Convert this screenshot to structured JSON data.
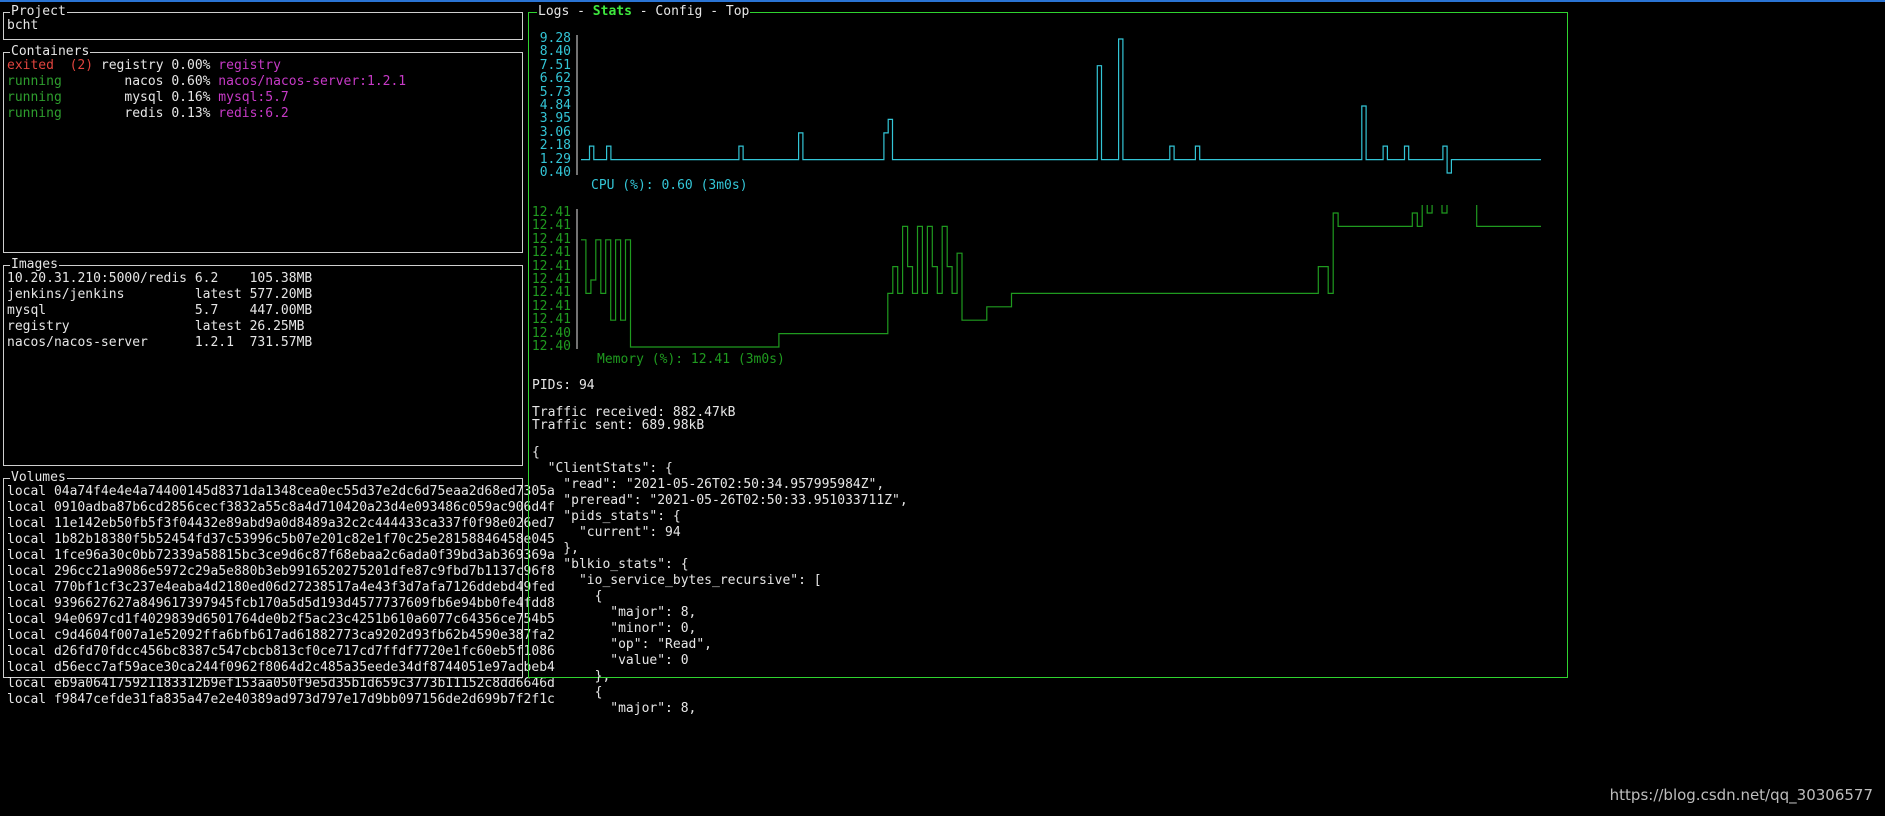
{
  "project": {
    "title": "Project",
    "name": "bcht"
  },
  "containers": {
    "title": "Containers",
    "rows": [
      {
        "state": "exited",
        "code": "(2)",
        "name": "registry",
        "cpu": "0.00%",
        "image": "registry"
      },
      {
        "state": "running",
        "code": "",
        "name": "nacos",
        "cpu": "0.60%",
        "image": "nacos/nacos-server:1.2.1"
      },
      {
        "state": "running",
        "code": "",
        "name": "mysql",
        "cpu": "0.16%",
        "image": "mysql:5.7"
      },
      {
        "state": "running",
        "code": "",
        "name": "redis",
        "cpu": "0.13%",
        "image": "redis:6.2"
      }
    ]
  },
  "images": {
    "title": "Images",
    "rows": [
      {
        "repo": "10.20.31.210:5000/redis",
        "tag": "6.2",
        "size": "105.38MB"
      },
      {
        "repo": "jenkins/jenkins",
        "tag": "latest",
        "size": "577.20MB"
      },
      {
        "repo": "mysql",
        "tag": "5.7",
        "size": "447.00MB"
      },
      {
        "repo": "registry",
        "tag": "latest",
        "size": "26.25MB"
      },
      {
        "repo": "nacos/nacos-server",
        "tag": "1.2.1",
        "size": "731.57MB"
      }
    ]
  },
  "volumes": {
    "title": "Volumes",
    "rows": [
      {
        "driver": "local",
        "name": "04a74f4e4e4a74400145d8371da1348cea0ec55d37e2dc6d75eaa2d68ed7305a"
      },
      {
        "driver": "local",
        "name": "0910adba87b6cd2856cecf3832a55c8a4d710420a23d4e093486c059ac906d4f"
      },
      {
        "driver": "local",
        "name": "11e142eb50fb5f3f04432e89abd9a0d8489a32c2c444433ca337f0f98e026ed7"
      },
      {
        "driver": "local",
        "name": "1b82b18380f5b52454fd37c53996c5b07e201c82e1f70c25e28158846458e045"
      },
      {
        "driver": "local",
        "name": "1fce96a30c0bb72339a58815bc3ce9d6c87f68ebaa2c6ada0f39bd3ab369369a"
      },
      {
        "driver": "local",
        "name": "296cc21a9086e5972c29a5e880b3eb9916520275201dfe87c9fbd7b1137c96f8"
      },
      {
        "driver": "local",
        "name": "770bf1cf3c237e4eaba4d2180ed06d27238517a4e43f3d7afa7126ddebd49fed"
      },
      {
        "driver": "local",
        "name": "9396627627a849617397945fcb170a5d5d193d4577737609fb6e94bb0fe4fdd8"
      },
      {
        "driver": "local",
        "name": "94e0697cd1f4029839d6501764de0b2f5ac23c4251b610a6077c64356ce754b5"
      },
      {
        "driver": "local",
        "name": "c9d4604f007a1e52092ffa6bfb617ad61882773ca9202d93fb62b4590e387fa2"
      },
      {
        "driver": "local",
        "name": "d26fd70fdcc456bc8387c547cbcb813cf0ce717cd7ffdf7720e1fc60eb5f1086"
      },
      {
        "driver": "local",
        "name": "d56ecc7af59ace30ca244f0962f8064d2c485a35eede34df8744051e97acbeb4"
      },
      {
        "driver": "local",
        "name": "eb9a064175921183312b9ef153aa050f9e5d35b1d659c3773b11152c8dd6646d"
      },
      {
        "driver": "local",
        "name": "f9847cefde31fa835a47e2e40389ad973d797e17d9bb097156de2d699b7f2f1c"
      }
    ]
  },
  "tabs": {
    "items": [
      {
        "label": "Logs",
        "active": false
      },
      {
        "label": "Stats",
        "active": true
      },
      {
        "label": "Config",
        "active": false
      },
      {
        "label": "Top",
        "active": false
      }
    ],
    "separator": "-"
  },
  "cpu_chart": {
    "ylabels": [
      "9.28",
      "8.40",
      "7.51",
      "6.62",
      "5.73",
      "4.84",
      "3.95",
      "3.06",
      "2.18",
      "1.29",
      "0.40"
    ],
    "caption": "CPU (%): 0.60 (3m0s)",
    "color": "#33c5d6"
  },
  "mem_chart": {
    "ylabels": [
      "12.41",
      "12.41",
      "12.41",
      "12.41",
      "12.41",
      "12.41",
      "12.41",
      "12.41",
      "12.41",
      "12.40",
      "12.40"
    ],
    "caption": "Memory (%): 12.41 (3m0s)",
    "color": "#1f9a1f"
  },
  "chart_data": [
    {
      "type": "line",
      "ylim": [
        0.4,
        9.28
      ],
      "series": [
        {
          "name": "CPU (%)",
          "values": [
            1.29,
            1.29,
            2.18,
            1.29,
            1.29,
            1.29,
            2.18,
            1.29,
            1.29,
            1.29,
            1.29,
            1.29,
            1.29,
            1.29,
            1.29,
            1.29,
            1.29,
            1.29,
            1.29,
            1.29,
            1.29,
            1.29,
            1.29,
            1.29,
            1.29,
            1.29,
            1.29,
            1.29,
            1.29,
            1.29,
            1.29,
            1.29,
            1.29,
            1.29,
            1.29,
            1.29,
            1.29,
            2.18,
            1.29,
            1.29,
            1.29,
            1.29,
            1.29,
            1.29,
            1.29,
            1.29,
            1.29,
            1.29,
            1.29,
            1.29,
            1.29,
            3.06,
            1.29,
            1.29,
            1.29,
            1.29,
            1.29,
            1.29,
            1.29,
            1.29,
            1.29,
            1.29,
            1.29,
            1.29,
            1.29,
            1.29,
            1.29,
            1.29,
            1.29,
            1.29,
            1.29,
            3.06,
            3.95,
            1.29,
            1.29,
            1.29,
            1.29,
            1.29,
            1.29,
            1.29,
            1.29,
            1.29,
            1.29,
            1.29,
            1.29,
            1.29,
            1.29,
            1.29,
            1.29,
            1.29,
            1.29,
            1.29,
            1.29,
            1.29,
            1.29,
            1.29,
            1.29,
            1.29,
            1.29,
            1.29,
            1.29,
            1.29,
            1.29,
            1.29,
            1.29,
            1.29,
            1.29,
            1.29,
            1.29,
            1.29,
            1.29,
            1.29,
            1.29,
            1.29,
            1.29,
            1.29,
            1.29,
            1.29,
            1.29,
            1.29,
            1.29,
            7.51,
            1.29,
            1.29,
            1.29,
            1.29,
            9.28,
            1.29,
            1.29,
            1.29,
            1.29,
            1.29,
            1.29,
            1.29,
            1.29,
            1.29,
            1.29,
            1.29,
            2.18,
            1.29,
            1.29,
            1.29,
            1.29,
            1.29,
            2.18,
            1.29,
            1.29,
            1.29,
            1.29,
            1.29,
            1.29,
            1.29,
            1.29,
            1.29,
            1.29,
            1.29,
            1.29,
            1.29,
            1.29,
            1.29,
            1.29,
            1.29,
            1.29,
            1.29,
            1.29,
            1.29,
            1.29,
            1.29,
            1.29,
            1.29,
            1.29,
            1.29,
            1.29,
            1.29,
            1.29,
            1.29,
            1.29,
            1.29,
            1.29,
            1.29,
            1.29,
            1.29,
            1.29,
            4.84,
            1.29,
            1.29,
            1.29,
            1.29,
            2.18,
            1.29,
            1.29,
            1.29,
            1.29,
            2.18,
            1.29,
            1.29,
            1.29,
            1.29,
            1.29,
            1.29,
            1.29,
            1.29,
            2.18,
            0.4,
            1.29,
            1.29,
            1.29,
            1.29,
            1.29,
            1.29,
            1.29,
            1.29,
            1.29,
            1.29,
            1.29,
            1.29,
            1.29,
            1.29,
            1.29,
            1.29,
            1.29,
            1.29,
            1.29,
            1.29,
            1.29
          ]
        }
      ]
    },
    {
      "type": "line",
      "ylim": [
        12.4,
        12.41
      ],
      "series": [
        {
          "name": "Memory (%)",
          "values": [
            12.408,
            12.404,
            12.405,
            12.408,
            12.404,
            12.408,
            12.402,
            12.408,
            12.402,
            12.408,
            12.4,
            12.4,
            12.4,
            12.4,
            12.4,
            12.4,
            12.4,
            12.4,
            12.4,
            12.4,
            12.4,
            12.4,
            12.4,
            12.4,
            12.4,
            12.4,
            12.4,
            12.4,
            12.4,
            12.4,
            12.4,
            12.4,
            12.4,
            12.4,
            12.4,
            12.4,
            12.4,
            12.4,
            12.4,
            12.4,
            12.401,
            12.401,
            12.401,
            12.401,
            12.401,
            12.401,
            12.401,
            12.401,
            12.401,
            12.401,
            12.401,
            12.401,
            12.401,
            12.401,
            12.401,
            12.401,
            12.401,
            12.401,
            12.401,
            12.401,
            12.401,
            12.401,
            12.404,
            12.406,
            12.404,
            12.409,
            12.406,
            12.404,
            12.409,
            12.404,
            12.409,
            12.406,
            12.404,
            12.409,
            12.406,
            12.404,
            12.407,
            12.402,
            12.402,
            12.402,
            12.402,
            12.402,
            12.403,
            12.403,
            12.403,
            12.403,
            12.403,
            12.404,
            12.404,
            12.404,
            12.404,
            12.404,
            12.404,
            12.404,
            12.404,
            12.404,
            12.404,
            12.404,
            12.404,
            12.404,
            12.404,
            12.404,
            12.404,
            12.404,
            12.404,
            12.404,
            12.404,
            12.404,
            12.404,
            12.404,
            12.404,
            12.404,
            12.404,
            12.404,
            12.404,
            12.404,
            12.404,
            12.404,
            12.404,
            12.404,
            12.404,
            12.404,
            12.404,
            12.404,
            12.404,
            12.404,
            12.404,
            12.404,
            12.404,
            12.404,
            12.404,
            12.404,
            12.404,
            12.404,
            12.404,
            12.404,
            12.404,
            12.404,
            12.404,
            12.404,
            12.404,
            12.404,
            12.404,
            12.404,
            12.404,
            12.404,
            12.404,
            12.404,
            12.404,
            12.406,
            12.406,
            12.404,
            12.41,
            12.409,
            12.409,
            12.409,
            12.409,
            12.409,
            12.409,
            12.409,
            12.409,
            12.409,
            12.409,
            12.409,
            12.409,
            12.409,
            12.409,
            12.409,
            12.41,
            12.409,
            12.411,
            12.41,
            12.411,
            12.412,
            12.41,
            12.412,
            12.412,
            12.411,
            12.411,
            12.412,
            12.411,
            12.409,
            12.409,
            12.409,
            12.409,
            12.409,
            12.409,
            12.409,
            12.409,
            12.409,
            12.409,
            12.409,
            12.409,
            12.409
          ]
        }
      ]
    }
  ],
  "pids": "PIDs: 94",
  "traffic_received": "Traffic received: 882.47kB",
  "traffic_sent": "Traffic sent: 689.98kB",
  "json_lines": [
    "{",
    "  \"ClientStats\": {",
    "    \"read\": \"2021-05-26T02:50:34.957995984Z\",",
    "    \"preread\": \"2021-05-26T02:50:33.951033711Z\",",
    "    \"pids_stats\": {",
    "      \"current\": 94",
    "    },",
    "    \"blkio_stats\": {",
    "      \"io_service_bytes_recursive\": [",
    "        {",
    "          \"major\": 8,",
    "          \"minor\": 0,",
    "          \"op\": \"Read\",",
    "          \"value\": 0",
    "        },",
    "        {",
    "          \"major\": 8,"
  ],
  "watermark": "https://blog.csdn.net/qq_30306577"
}
